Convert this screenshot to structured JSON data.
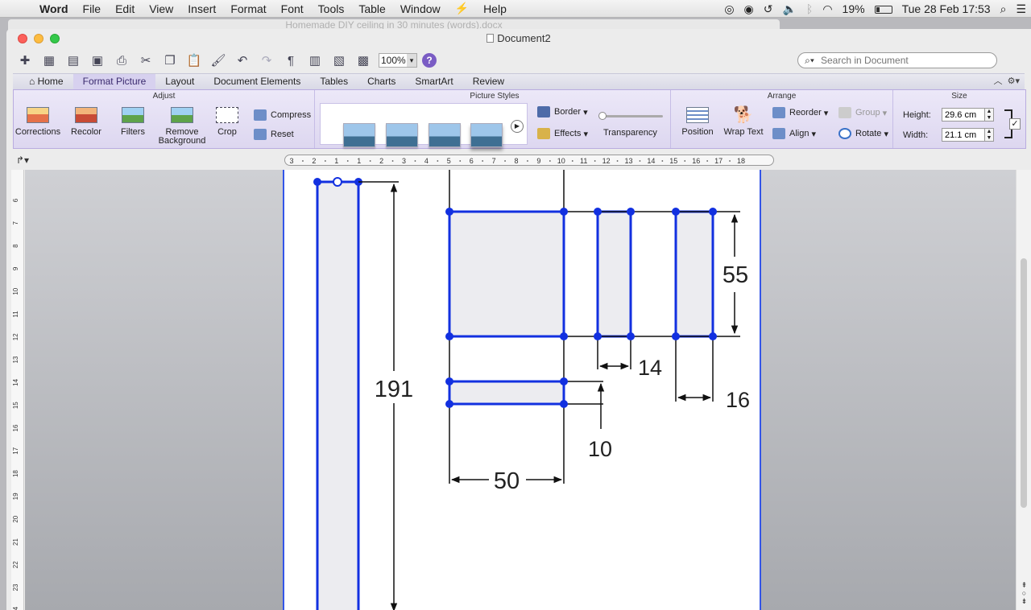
{
  "menubar": {
    "apple": "",
    "items": [
      "Word",
      "File",
      "Edit",
      "View",
      "Insert",
      "Format",
      "Font",
      "Tools",
      "Table",
      "Window",
      "Help"
    ],
    "battery": "19%",
    "datetime": "Tue 28 Feb  17:53"
  },
  "window": {
    "background_title": "Homemade DIY ceiling in 30 minutes (words).docx",
    "title": "Document2"
  },
  "toolbar": {
    "zoom": "100%",
    "search_placeholder": "Search in Document"
  },
  "tabs": [
    "Home",
    "Format Picture",
    "Layout",
    "Document Elements",
    "Tables",
    "Charts",
    "SmartArt",
    "Review"
  ],
  "ribbon": {
    "groups": {
      "adjust": "Adjust",
      "picture_styles": "Picture Styles",
      "arrange": "Arrange",
      "size": "Size"
    },
    "adjust": {
      "corrections": "Corrections",
      "recolor": "Recolor",
      "filters": "Filters",
      "remove_background": "Remove Background",
      "crop": "Crop",
      "compress": "Compress",
      "reset": "Reset"
    },
    "styles": {
      "border": "Border",
      "effects": "Effects",
      "transparency": "Transparency",
      "transparency_level": 0
    },
    "arrange": {
      "position": "Position",
      "wrap_text": "Wrap Text",
      "reorder": "Reorder",
      "align": "Align",
      "group": "Group",
      "rotate": "Rotate"
    },
    "size": {
      "height_label": "Height:",
      "height_value": "29.6 cm",
      "width_label": "Width:",
      "width_value": "21.1 cm"
    }
  },
  "ruler": {
    "labels": [
      "3",
      "2",
      "1",
      "1",
      "2",
      "3",
      "4",
      "5",
      "6",
      "7",
      "8",
      "9",
      "10",
      "11",
      "12",
      "13",
      "14",
      "15",
      "16",
      "17",
      "18"
    ]
  },
  "vruler": {
    "labels": [
      "6",
      "7",
      "8",
      "9",
      "10",
      "11",
      "12",
      "13",
      "14",
      "15",
      "16",
      "17",
      "18",
      "19",
      "20",
      "21",
      "22",
      "23",
      "24"
    ]
  },
  "drawing": {
    "dim_191": "191",
    "dim_55": "55",
    "dim_14": "14",
    "dim_16": "16",
    "dim_10": "10",
    "dim_50": "50"
  }
}
